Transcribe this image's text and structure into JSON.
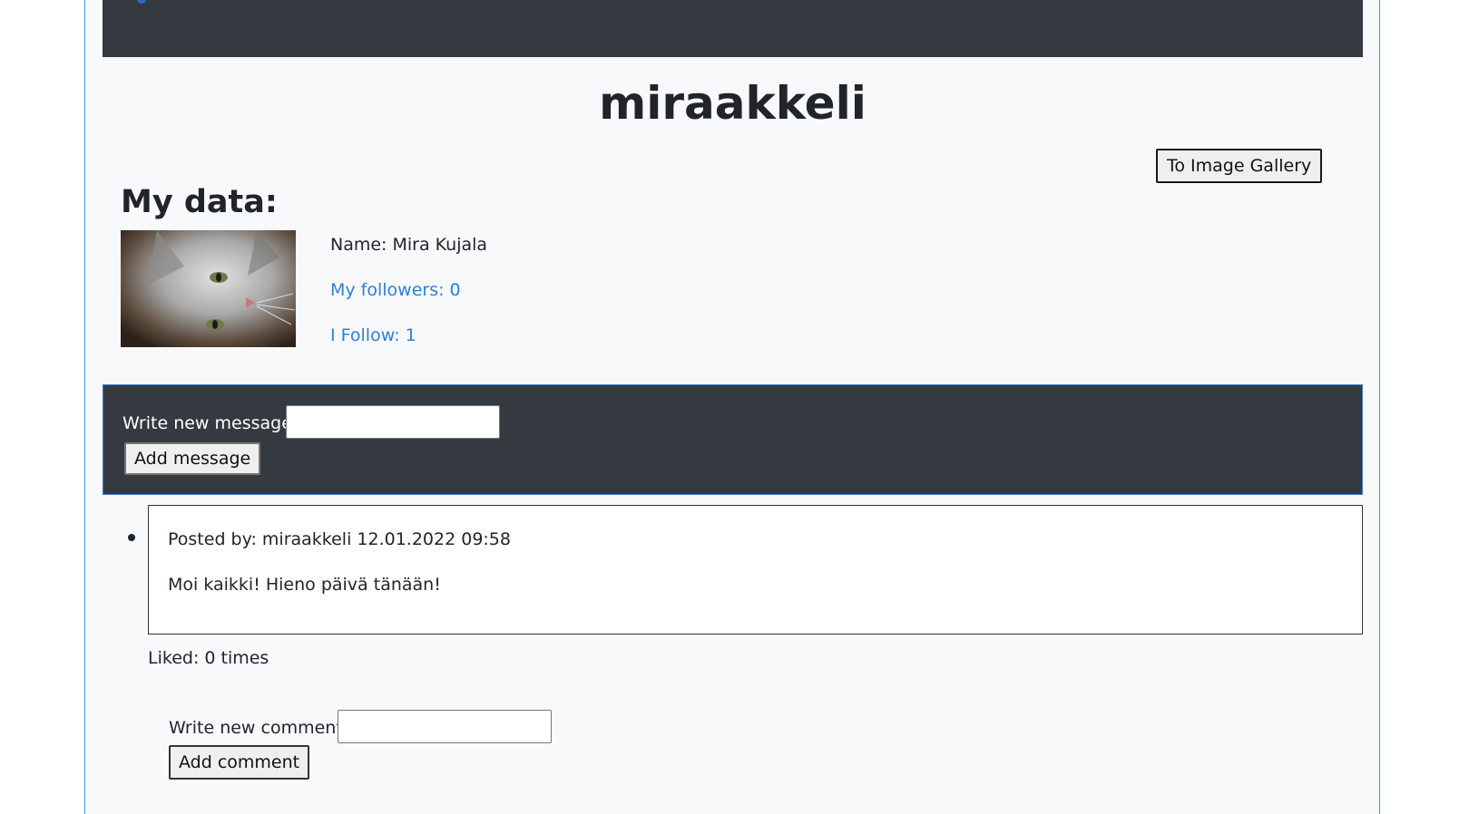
{
  "profile": {
    "username": "miraakkeli",
    "gallery_button": "To Image Gallery",
    "heading": "My data:",
    "avatar_alt": "cat-photo",
    "name_line": "Name: Mira Kujala",
    "followers_line": "My followers: 0",
    "follow_line": "I Follow: 1"
  },
  "new_message": {
    "label": "Write new message:",
    "value": "",
    "button": "Add message"
  },
  "posts": [
    {
      "meta": "Posted by: miraakkeli 12.01.2022 09:58",
      "text": "Moi kaikki! Hieno päivä tänään!",
      "liked": "Liked: 0 times",
      "comment_label": "Write new comment:",
      "comment_value": "",
      "comment_button": "Add comment"
    }
  ],
  "colors": {
    "navbar": "#343a40",
    "link": "#2f7fd6",
    "page_bg": "#f8f9fa"
  }
}
